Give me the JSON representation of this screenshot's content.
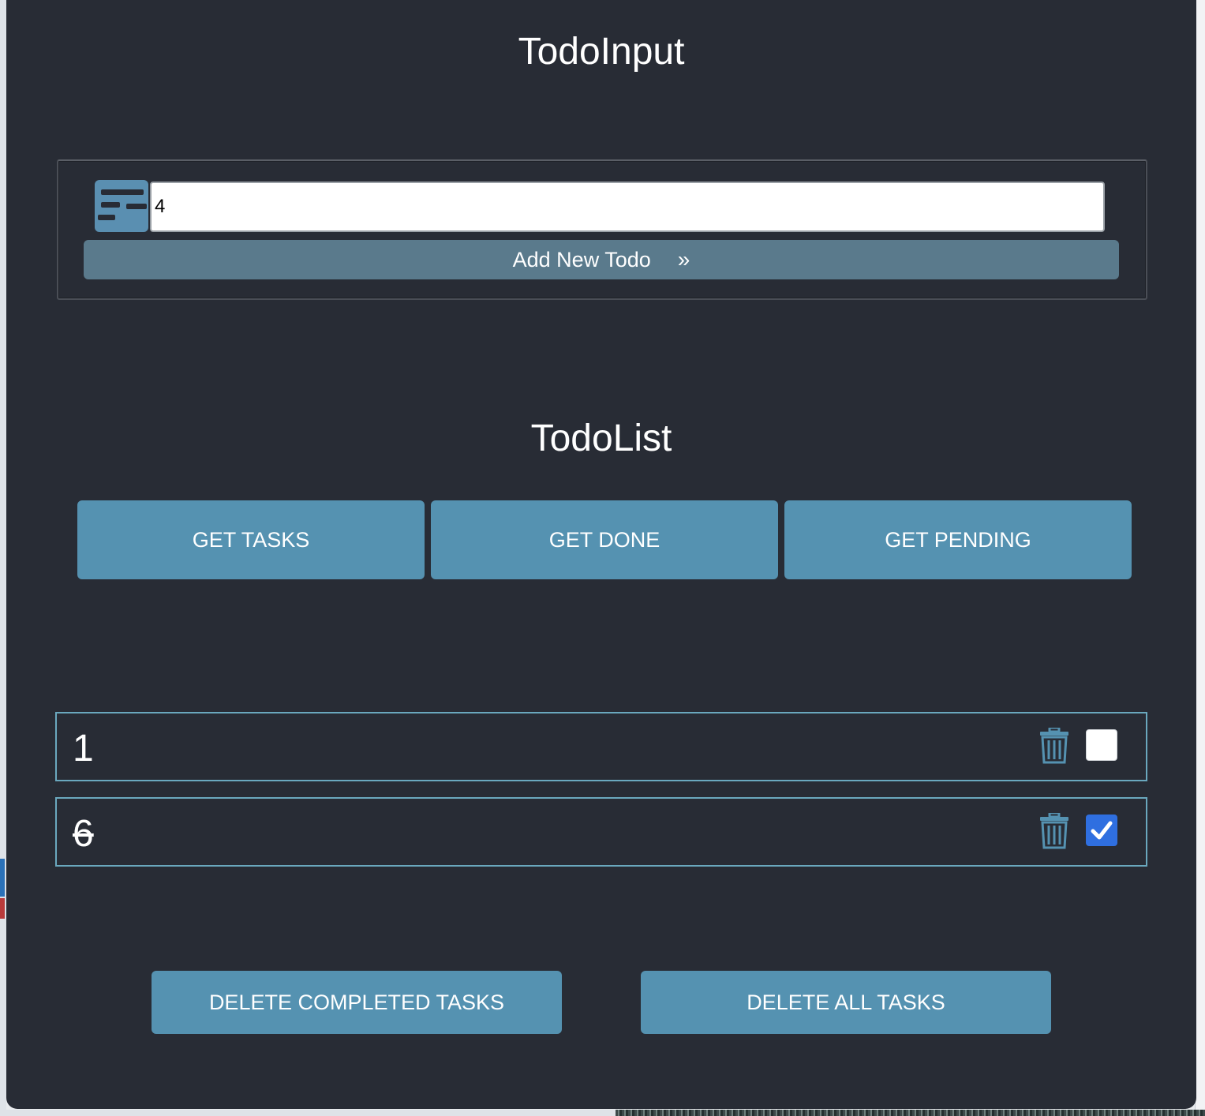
{
  "todo_input": {
    "title": "TodoInput",
    "input_value": "4",
    "add_button_label": "Add New Todo",
    "add_button_chevron": "»"
  },
  "todo_list": {
    "title": "TodoList",
    "filters": [
      {
        "label": "GET TASKS"
      },
      {
        "label": "GET DONE"
      },
      {
        "label": "GET PENDING"
      }
    ],
    "items": [
      {
        "text": "1",
        "completed": false
      },
      {
        "text": "6",
        "completed": true
      }
    ],
    "actions": {
      "delete_completed_label": "DELETE COMPLETED TASKS",
      "delete_all_label": "DELETE ALL TASKS"
    }
  },
  "icons": {
    "input_icon": "calendar-icon",
    "delete_icon": "trash-icon",
    "checkbox_checked": "checkmark-icon"
  },
  "colors": {
    "background": "#282c35",
    "button": "#5592b1",
    "add_button": "#5a7a8c",
    "item_border": "#6aa8be",
    "checkbox_checked": "#2f6fe0",
    "icon": "#5a8fb1"
  }
}
